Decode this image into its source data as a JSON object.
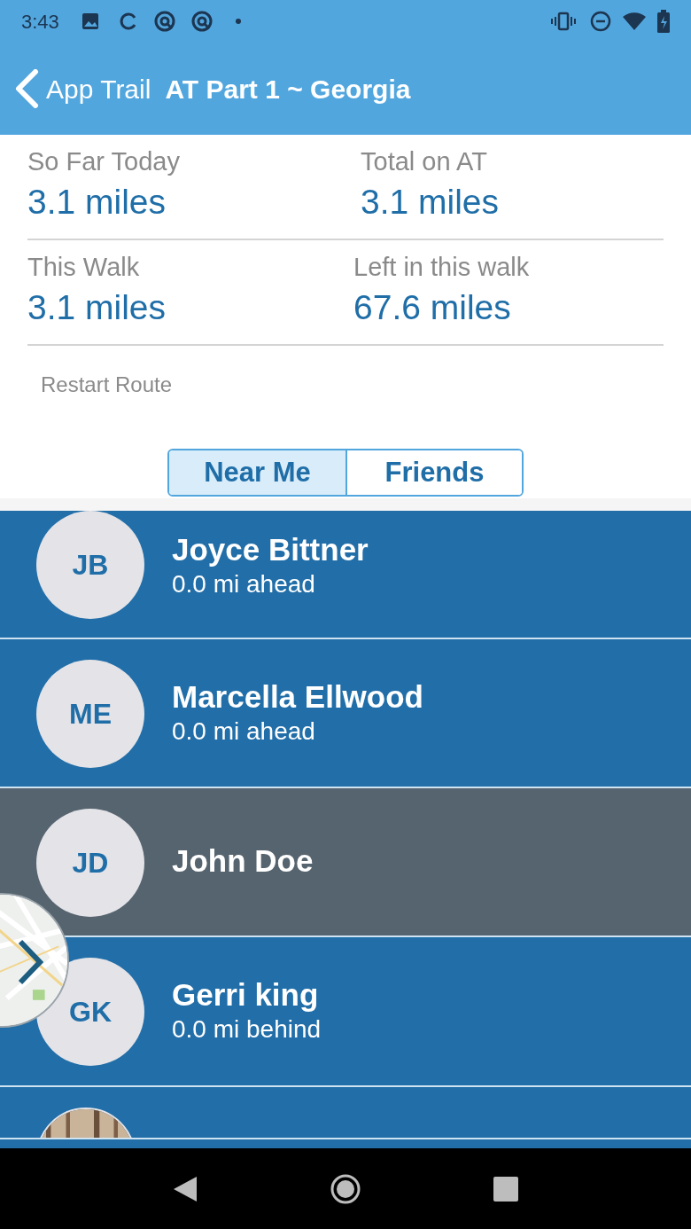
{
  "status_bar": {
    "time": "3:43"
  },
  "app_bar": {
    "back_label": "App Trail",
    "title": "AT Part 1 ~ Georgia"
  },
  "stats": [
    {
      "label": "So Far Today",
      "value": "3.1 miles"
    },
    {
      "label": "Total on AT",
      "value": "3.1 miles"
    },
    {
      "label": "This Walk",
      "value": "3.1 miles"
    },
    {
      "label": "Left in this walk",
      "value": "67.6 miles"
    }
  ],
  "restart_link": "Restart Route",
  "segments": [
    {
      "label": "Near Me",
      "selected": true
    },
    {
      "label": "Friends",
      "selected": false
    }
  ],
  "people": [
    {
      "kind": "initials",
      "initials": "JB",
      "name": "Joyce Bittner",
      "distance": "0.0 mi ahead",
      "selected": false
    },
    {
      "kind": "initials",
      "initials": "ME",
      "name": "Marcella Ellwood",
      "distance": "0.0 mi ahead",
      "selected": false
    },
    {
      "kind": "initials",
      "initials": "JD",
      "name": "John Doe",
      "selected": true
    },
    {
      "kind": "initials",
      "initials": "GK",
      "name": "Gerri king",
      "distance": "0.0 mi behind",
      "selected": false
    },
    {
      "kind": "picture",
      "selected": false
    }
  ]
}
